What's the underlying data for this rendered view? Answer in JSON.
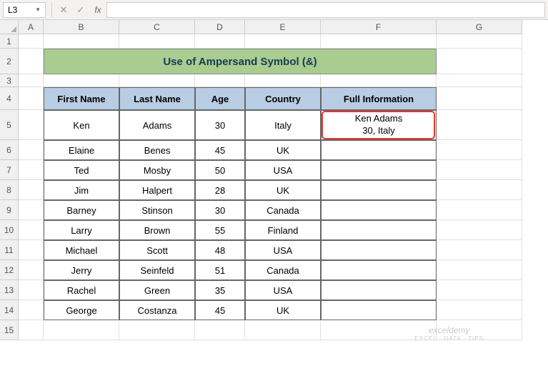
{
  "name_box": "L3",
  "title": "Use of Ampersand Symbol (&)",
  "columns": [
    "A",
    "B",
    "C",
    "D",
    "E",
    "F",
    "G"
  ],
  "rows": [
    "1",
    "2",
    "3",
    "4",
    "5",
    "6",
    "7",
    "8",
    "9",
    "10",
    "11",
    "12",
    "13",
    "14",
    "15"
  ],
  "headers": {
    "first_name": "First Name",
    "last_name": "Last Name",
    "age": "Age",
    "country": "Country",
    "full_info": "Full Information"
  },
  "chart_data": {
    "type": "table",
    "columns": [
      "First Name",
      "Last Name",
      "Age",
      "Country",
      "Full Information"
    ],
    "rows": [
      {
        "first": "Ken",
        "last": "Adams",
        "age": "30",
        "country": "Italy",
        "full_line1": "Ken  Adams",
        "full_line2": "30, Italy"
      },
      {
        "first": "Elaine",
        "last": "Benes",
        "age": "45",
        "country": "UK",
        "full_line1": "",
        "full_line2": ""
      },
      {
        "first": "Ted",
        "last": "Mosby",
        "age": "50",
        "country": "USA",
        "full_line1": "",
        "full_line2": ""
      },
      {
        "first": "Jim",
        "last": "Halpert",
        "age": "28",
        "country": "UK",
        "full_line1": "",
        "full_line2": ""
      },
      {
        "first": "Barney",
        "last": "Stinson",
        "age": "30",
        "country": "Canada",
        "full_line1": "",
        "full_line2": ""
      },
      {
        "first": "Larry",
        "last": "Brown",
        "age": "55",
        "country": "Finland",
        "full_line1": "",
        "full_line2": ""
      },
      {
        "first": "Michael",
        "last": "Scott",
        "age": "48",
        "country": "USA",
        "full_line1": "",
        "full_line2": ""
      },
      {
        "first": "Jerry",
        "last": "Seinfeld",
        "age": "51",
        "country": "Canada",
        "full_line1": "",
        "full_line2": ""
      },
      {
        "first": "Rachel",
        "last": "Green",
        "age": "35",
        "country": "USA",
        "full_line1": "",
        "full_line2": ""
      },
      {
        "first": "George",
        "last": "Costanza",
        "age": "45",
        "country": "UK",
        "full_line1": "",
        "full_line2": ""
      }
    ]
  },
  "watermark": {
    "main": "exceldemy",
    "sub": "EXCEL · DATA · TIPS"
  }
}
